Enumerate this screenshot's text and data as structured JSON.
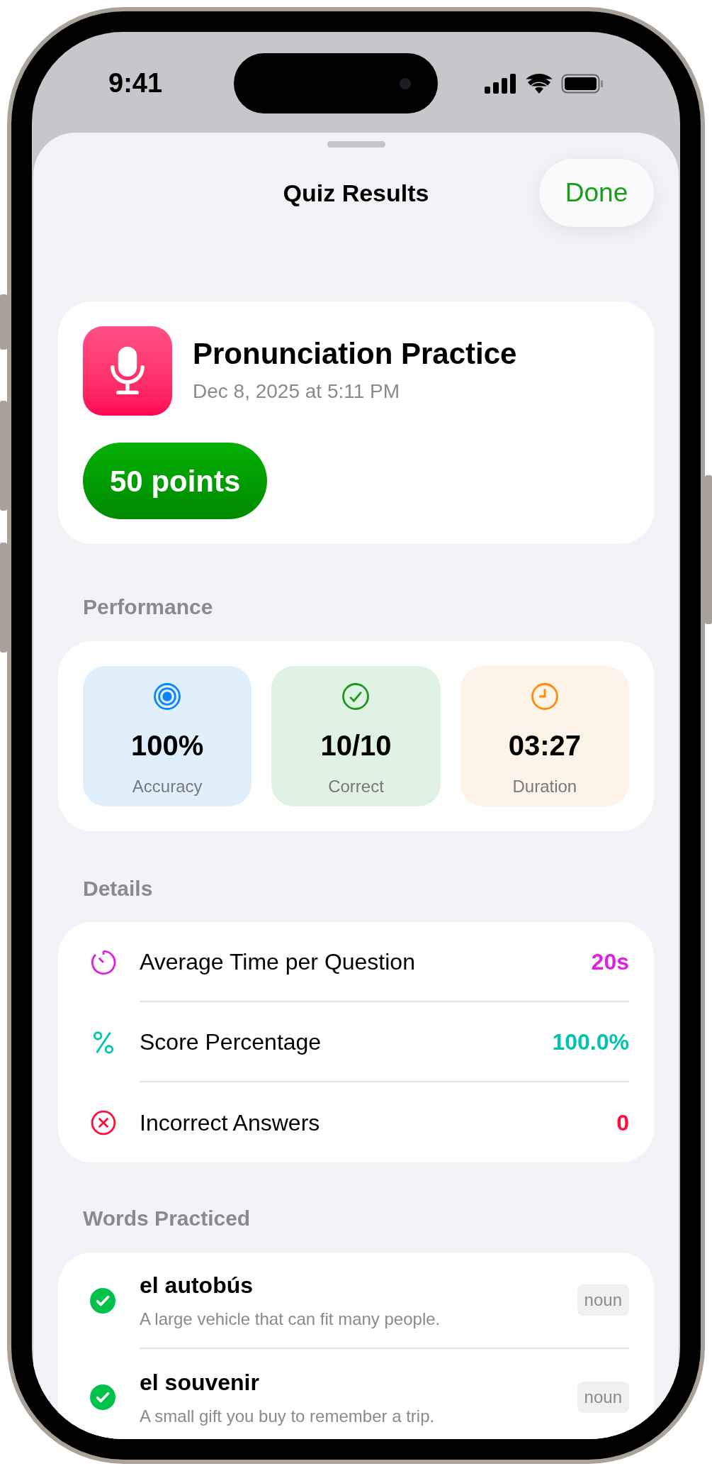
{
  "status_bar": {
    "time": "9:41"
  },
  "sheet": {
    "title": "Quiz Results",
    "done_button": "Done"
  },
  "summary": {
    "title": "Pronunciation Practice",
    "date": "Dec 8, 2025 at 5:11 PM",
    "points": "50 points"
  },
  "performance": {
    "header": "Performance",
    "stats": [
      {
        "kind": "target",
        "value": "100%",
        "label": "Accuracy",
        "color": "#0a84ff"
      },
      {
        "kind": "check",
        "value": "10/10",
        "label": "Correct",
        "color": "#1a9a1a"
      },
      {
        "kind": "clock",
        "value": "03:27",
        "label": "Duration",
        "color": "#ff8c00"
      }
    ]
  },
  "details": {
    "header": "Details",
    "rows": [
      {
        "kind": "timer",
        "label": "Average Time per Question",
        "value": "20s",
        "color": "#e020e0"
      },
      {
        "kind": "percent",
        "label": "Score Percentage",
        "value": "100.0%",
        "color": "#00c4b0"
      },
      {
        "kind": "cross",
        "label": "Incorrect Answers",
        "value": "0",
        "color": "#ff1038"
      }
    ]
  },
  "words": {
    "header": "Words Practiced",
    "items": [
      {
        "word": "el autobús",
        "definition": "A large vehicle that can fit many people.",
        "tag": "noun",
        "correct": true
      },
      {
        "word": "el souvenir",
        "definition": "A small gift you buy to remember a trip.",
        "tag": "noun",
        "correct": true
      }
    ]
  }
}
